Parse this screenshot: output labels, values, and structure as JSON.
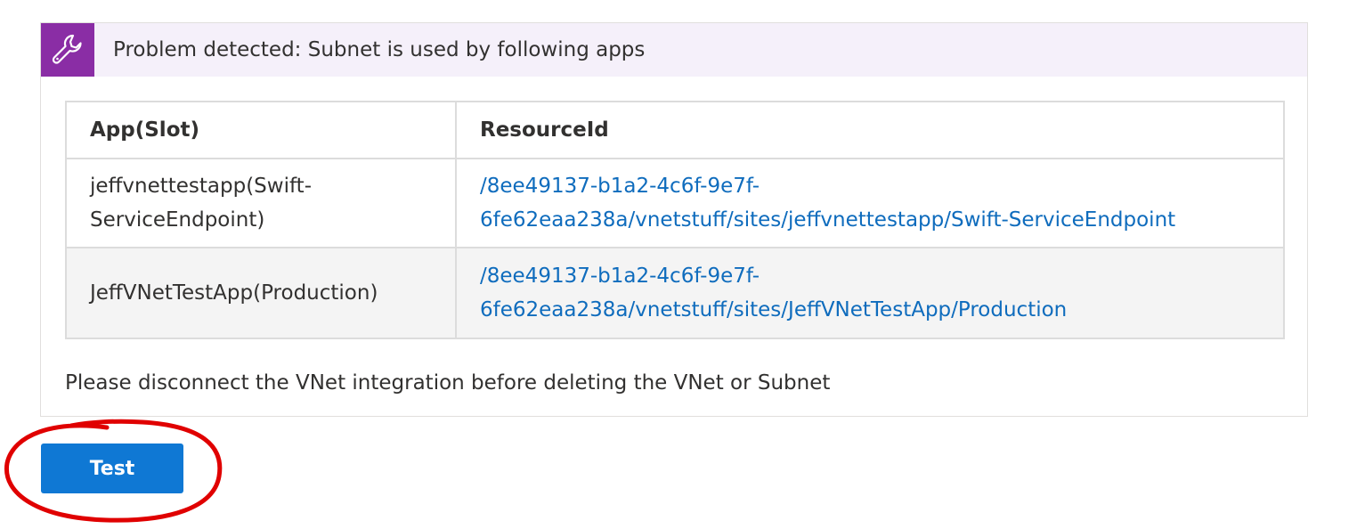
{
  "problem": {
    "icon": "wrench-icon",
    "title": "Problem detected: Subnet is used by following apps",
    "accent_color": "#8a2da5"
  },
  "table": {
    "headers": [
      "App(Slot)",
      "ResourceId"
    ],
    "rows": [
      {
        "app_line1": "jeffvnettestapp(Swift-",
        "app_line2": "ServiceEndpoint)",
        "resource_line1": "/8ee49137-b1a2-4c6f-9e7f-",
        "resource_line2": "6fe62eaa238a/vnetstuff/sites/jeffvnettestapp/Swift-ServiceEndpoint"
      },
      {
        "app": "JeffVNetTestApp(Production)",
        "resource_line1": "/8ee49137-b1a2-4c6f-9e7f-",
        "resource_line2": "6fe62eaa238a/vnetstuff/sites/JeffVNetTestApp/Production"
      }
    ]
  },
  "footer_note": "Please disconnect the VNet integration before deleting the VNet or Subnet",
  "test_button": {
    "label": "Test",
    "color": "#0f78d4"
  },
  "annotation_color": "#e00000"
}
